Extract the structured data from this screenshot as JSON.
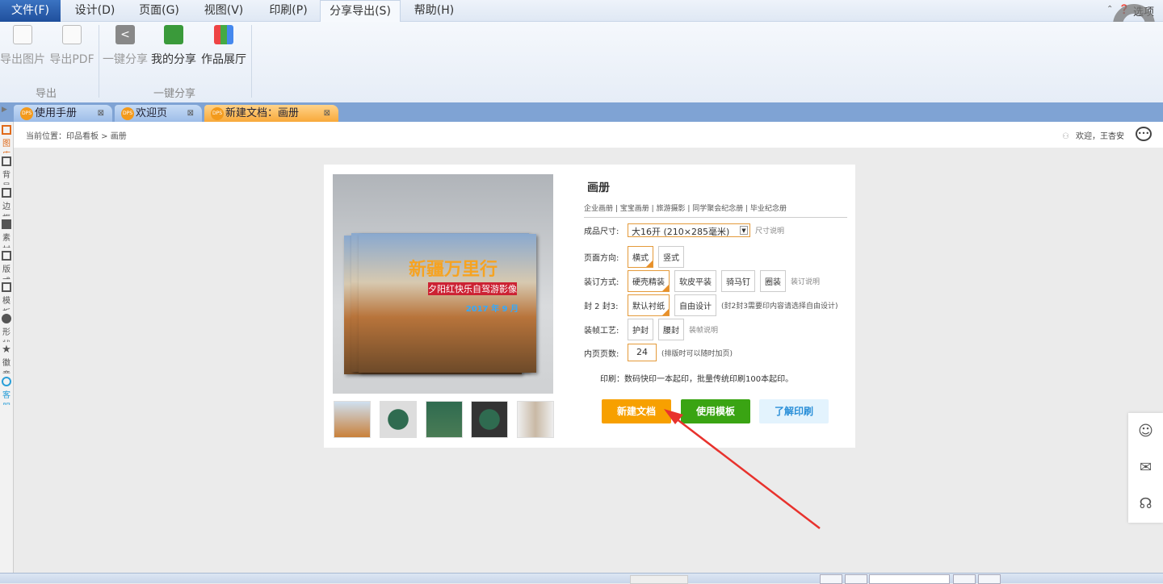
{
  "menu": [
    "文件(F)",
    "设计(D)",
    "页面(G)",
    "视图(V)",
    "印刷(P)",
    "分享导出(S)",
    "帮助(H)"
  ],
  "options_label": "选项",
  "ribbon": {
    "export_image": "导出图片",
    "export_pdf": "导出PDF",
    "export_group": "导出",
    "one_click_share": "一键分享",
    "my_share": "我的分享",
    "gallery": "作品展厅",
    "share_group": "一键分享"
  },
  "tabs": [
    "使用手册",
    "欢迎页",
    "新建文档：画册"
  ],
  "tab_logo": "DPS",
  "sidebar": [
    "图库",
    "背景",
    "边框",
    "素材",
    "版式",
    "模板",
    "形状",
    "徽章",
    "客服"
  ],
  "breadcrumb": "当前位置：印品看板 > 画册",
  "welcome": "欢迎，王杏安",
  "cover": {
    "title": "新疆万里行",
    "subtitle": "夕阳红快乐自驾游影像",
    "date": "2017 年 9 月"
  },
  "product": {
    "title": "画册",
    "categories": "企业画册 | 宝宝画册 | 旅游摄影 | 同学聚会纪念册 | 毕业纪念册",
    "size_label": "成品尺寸:",
    "size_value": "大16开 (210×285毫米)",
    "size_note": "尺寸说明",
    "orient_label": "页面方向:",
    "orient": [
      "横式",
      "竖式"
    ],
    "binding_label": "装订方式:",
    "binding": [
      "硬壳精装",
      "软皮平装",
      "骑马钉",
      "圈装"
    ],
    "binding_note": "装订说明",
    "cover23_label": "封 2 封3:",
    "cover23": [
      "默认衬纸",
      "自由设计"
    ],
    "cover23_note": "(封2封3需要印内容请选择自由设计)",
    "craft_label": "装帧工艺:",
    "craft": [
      "护封",
      "腰封"
    ],
    "craft_note": "装帧说明",
    "pages_label": "内页页数:",
    "pages_value": "24",
    "pages_note": "(排版时可以随时加页)",
    "print_note": "印刷：数码快印一本起印，批量传统印刷100本起印。",
    "btn_new": "新建文档",
    "btn_template": "使用模板",
    "btn_learn": "了解印刷"
  },
  "colors": {
    "accent": "#f7a000",
    "green": "#3aa413",
    "arrow": "#e8322d"
  }
}
